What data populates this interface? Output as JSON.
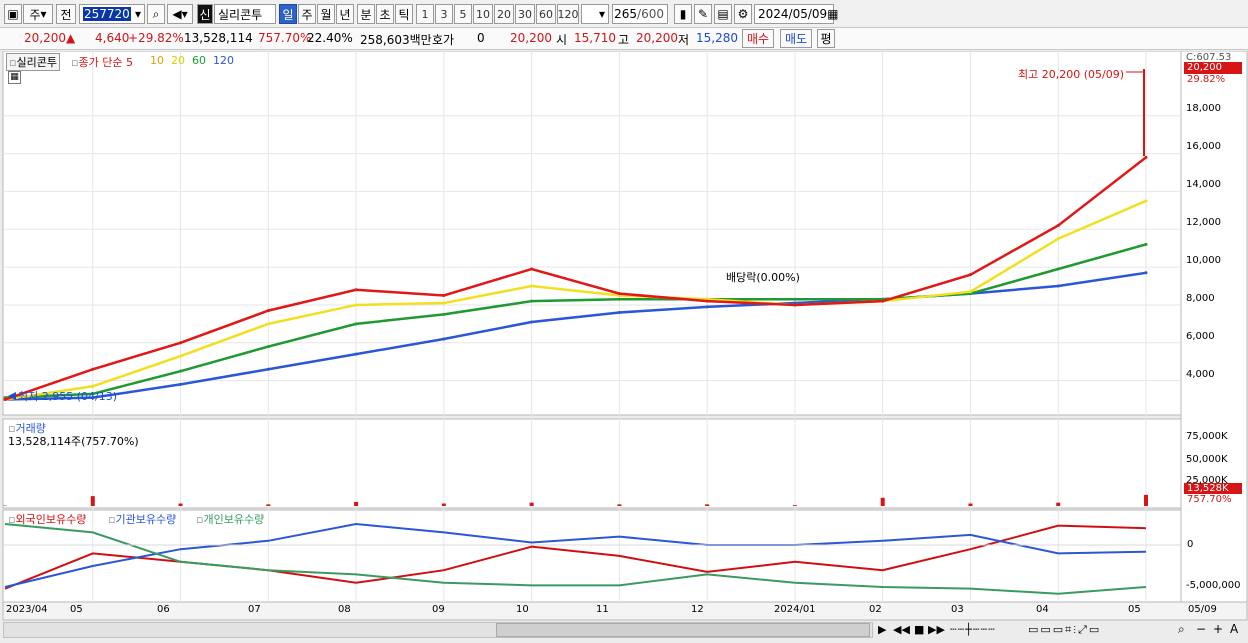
{
  "toolbar": {
    "mode_primary": "주",
    "mode_prev": "전",
    "code": "257720",
    "stock_badge": "신",
    "stock_name": "실리콘투",
    "periods": [
      "일",
      "주",
      "월",
      "년",
      "분",
      "초",
      "틱"
    ],
    "active_period": "일",
    "intervals": [
      "1",
      "3",
      "5",
      "10",
      "20",
      "30",
      "60",
      "120"
    ],
    "count": "265",
    "count_max": "/600",
    "date": "2024/05/09"
  },
  "quote": {
    "price": "20,200",
    "change": "4,640",
    "change_pct": "+29.82%",
    "volume": "13,528,114",
    "volume_ratio": "757.70%",
    "turnover": "22.40%",
    "amount": "258,603백만",
    "bid_label": "호가",
    "bid_value": "0",
    "ask_value": "20,200",
    "open_label": "시",
    "open": "15,710",
    "high_label": "고",
    "high": "20,200",
    "low_label": "저",
    "low": "15,280",
    "buy_label": "매수",
    "sell_label": "매도",
    "avg_label": "평"
  },
  "price_panel": {
    "title": "실리콘투",
    "legend_close": "종가 단순 5",
    "ma_labels": [
      "10",
      "20",
      "60",
      "120"
    ],
    "top_label": "C:607.53",
    "last_price": "20,200",
    "last_pct": "29.82%",
    "y_ticks": [
      "18,000",
      "16,000",
      "14,000",
      "12,000",
      "10,000",
      "8,000",
      "6,000",
      "4,000"
    ],
    "high_annotation": "최고 20,200 (05/09)",
    "low_annotation": "최저 2,955 (04/13)",
    "dividend_annotation": "배당락(0.00%)"
  },
  "volume_panel": {
    "title": "거래량",
    "summary": "13,528,114주(757.70%)",
    "y_ticks": [
      "75,000K",
      "50,000K",
      "25,000K"
    ],
    "last_value": "13,528K",
    "last_pct": "757.70%"
  },
  "holdings_panel": {
    "legend": [
      "외국인보유수량",
      "기관보유수량",
      "개인보유수량"
    ],
    "y_ticks": [
      "0",
      "-5,000,000"
    ]
  },
  "x_axis": {
    "labels": [
      "2023/04",
      "05",
      "06",
      "07",
      "08",
      "09",
      "10",
      "11",
      "12",
      "2024/01",
      "02",
      "03",
      "04",
      "05",
      "05/09"
    ]
  },
  "chart_data": {
    "type": "line",
    "title": "실리콘투",
    "x": [
      "2023/04",
      "05",
      "06",
      "07",
      "08",
      "09",
      "10",
      "11",
      "12",
      "2024/01",
      "02",
      "03",
      "04",
      "05"
    ],
    "series": [
      {
        "name": "종가 단순 5",
        "color": "#e01818",
        "values": [
          3000,
          4600,
          6000,
          7700,
          8800,
          8500,
          9900,
          8600,
          8200,
          8000,
          8200,
          9600,
          12200,
          15800
        ]
      },
      {
        "name": "20",
        "color": "#f0e020",
        "values": [
          3000,
          3700,
          5300,
          7000,
          8000,
          8100,
          9000,
          8500,
          8300,
          8000,
          8200,
          8700,
          11500,
          13500
        ]
      },
      {
        "name": "60",
        "color": "#1e9a30",
        "values": [
          3100,
          3300,
          4500,
          5800,
          7000,
          7500,
          8200,
          8300,
          8300,
          8300,
          8300,
          8600,
          9900,
          11200
        ]
      },
      {
        "name": "120",
        "color": "#2a56d8",
        "values": [
          3000,
          3100,
          3800,
          4600,
          5400,
          6200,
          7100,
          7600,
          7900,
          8100,
          8300,
          8600,
          9000,
          9700
        ]
      }
    ],
    "volume": [
      0.5,
      12,
      3,
      2,
      5,
      3,
      4,
      2,
      2,
      1,
      10,
      3,
      4,
      13.5
    ],
    "holdings": [
      {
        "name": "외국인보유수량",
        "color": "#d01010",
        "values": [
          -5.2,
          -1.0,
          -2.0,
          -3.0,
          -4.5,
          -3.0,
          -0.2,
          -1.3,
          -3.2,
          -2.0,
          -3.0,
          -0.5,
          2.3,
          2.0
        ]
      },
      {
        "name": "기관보유수량",
        "color": "#2a56d8",
        "values": [
          -5.0,
          -2.5,
          -0.5,
          0.5,
          2.5,
          1.5,
          0.3,
          1.0,
          0.0,
          0.0,
          0.5,
          1.2,
          -1.0,
          -0.8
        ]
      },
      {
        "name": "개인보유수량",
        "color": "#3a9a60",
        "values": [
          2.5,
          1.5,
          -2.0,
          -3.0,
          -3.5,
          -4.5,
          -4.8,
          -4.8,
          -3.5,
          -4.5,
          -5.0,
          -5.2,
          -5.8,
          -5.0
        ]
      }
    ],
    "ylim": [
      2500,
      21000
    ],
    "grid": true
  }
}
